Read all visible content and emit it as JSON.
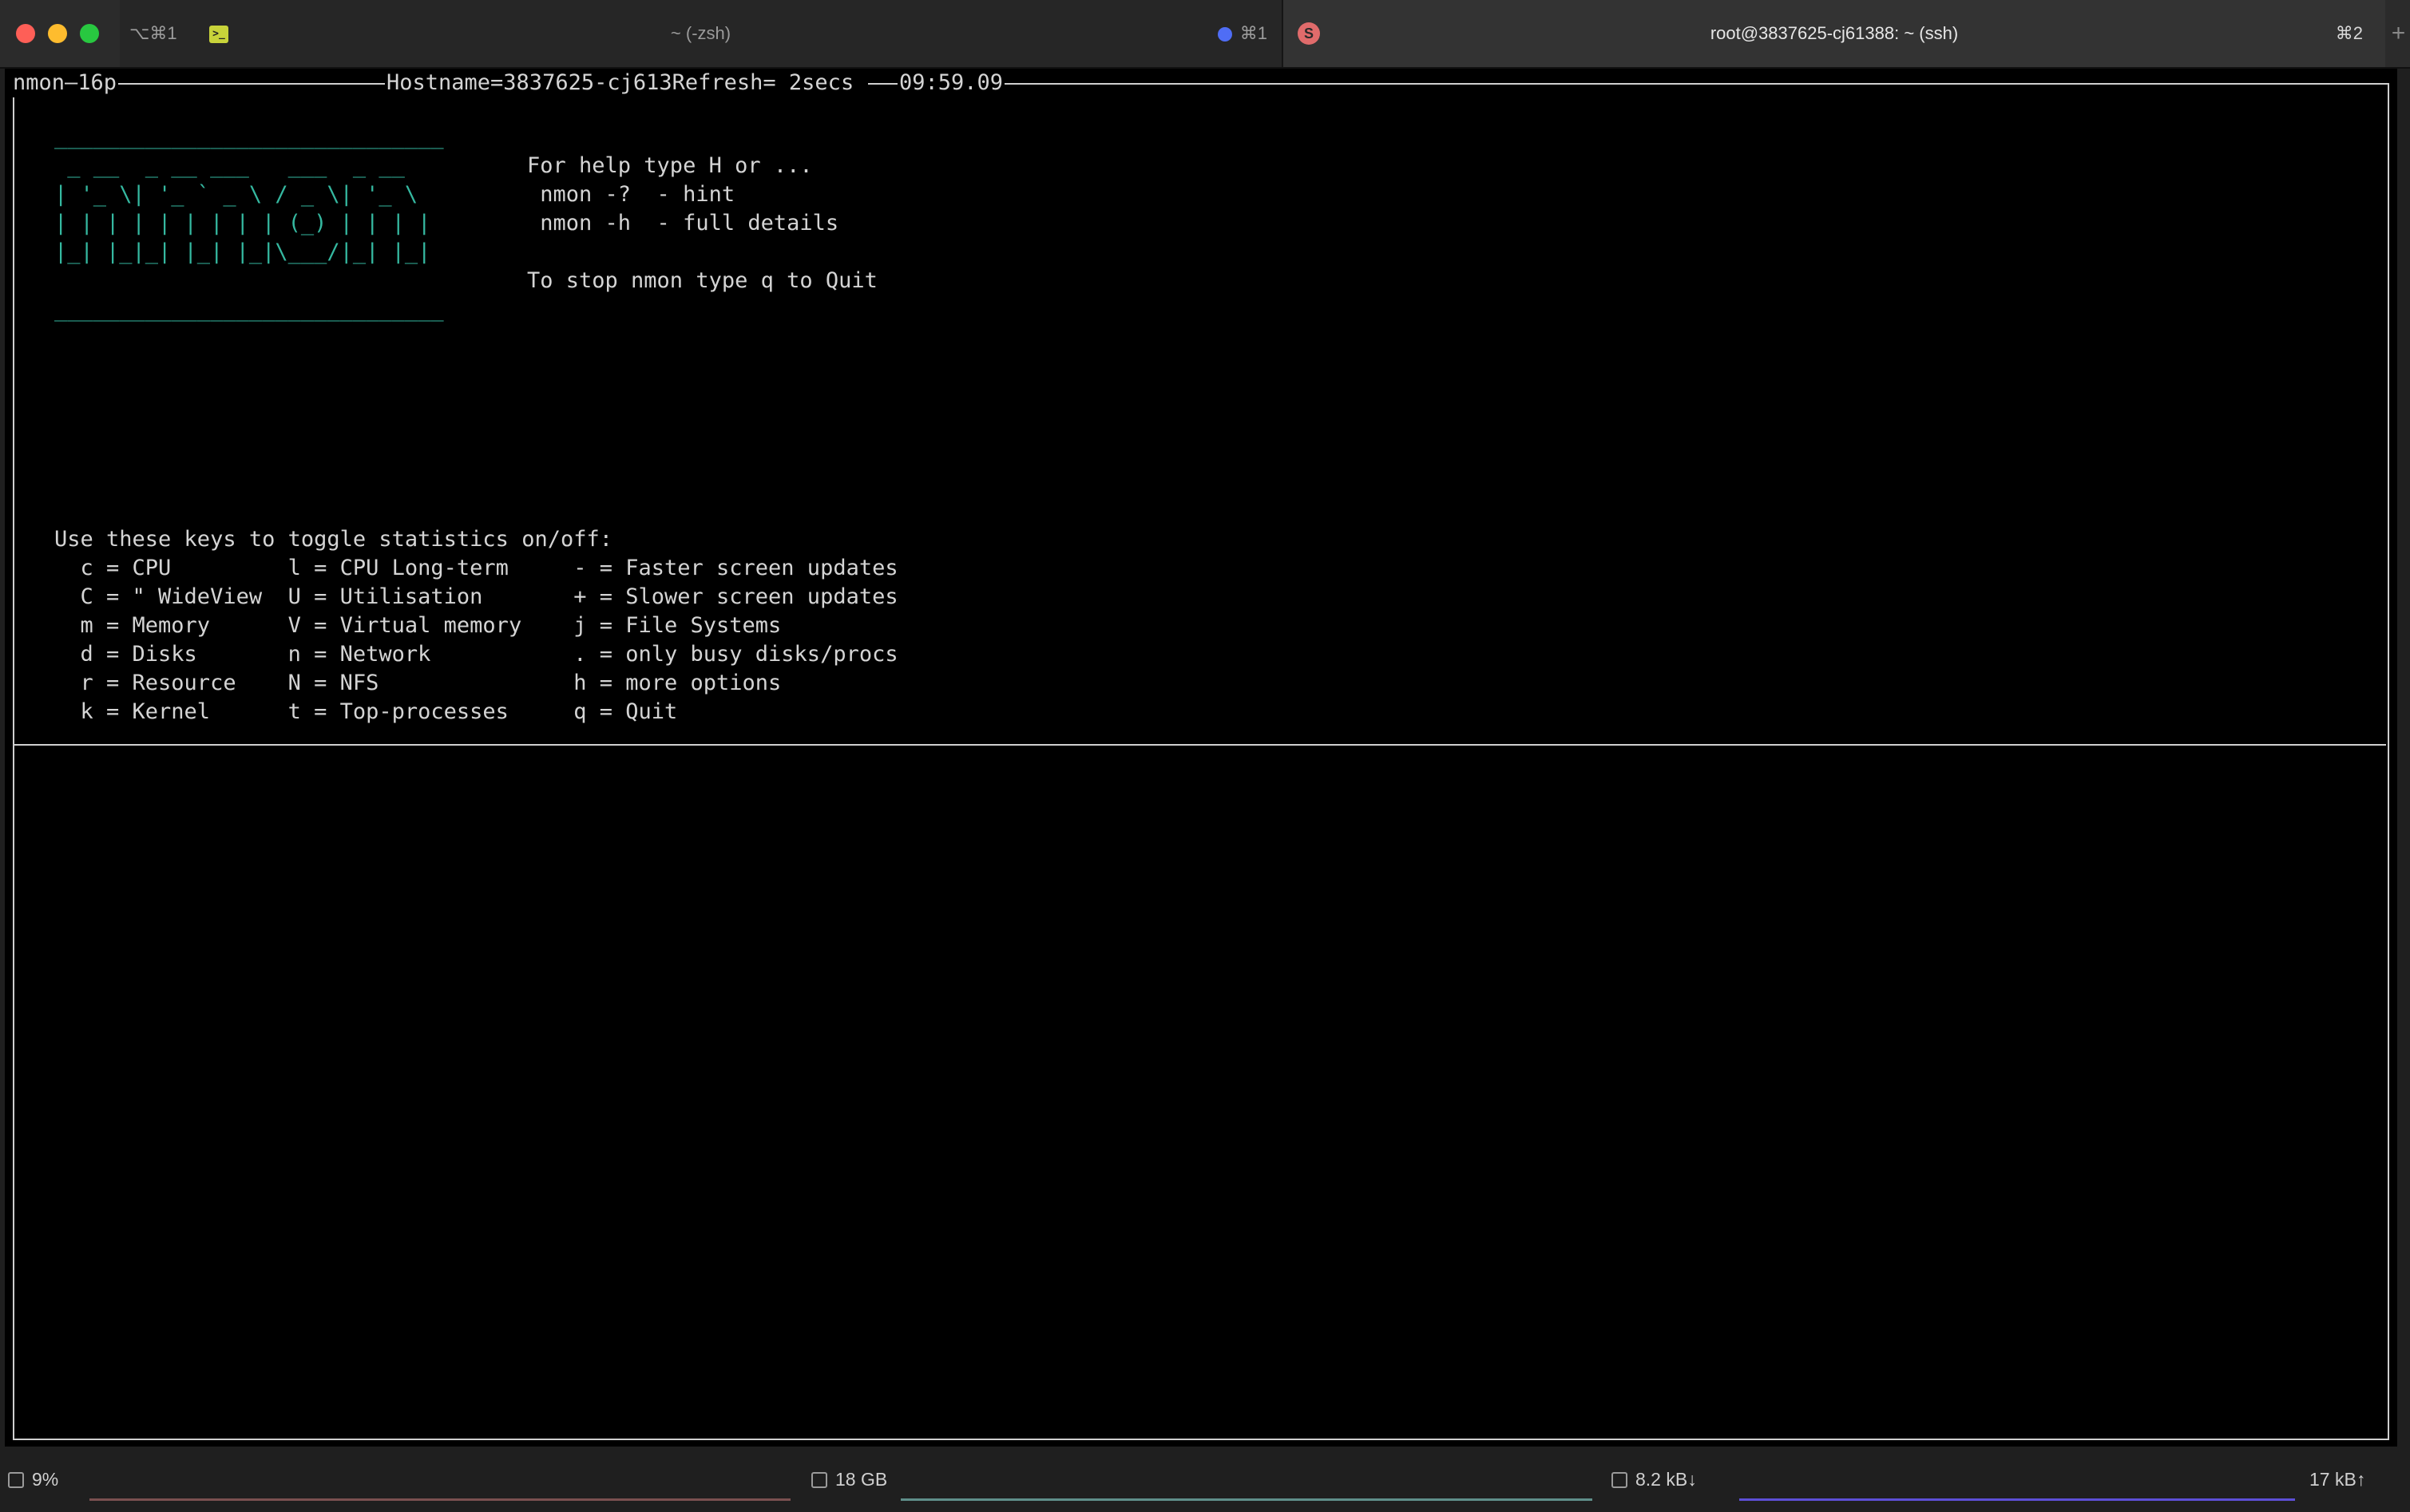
{
  "window": {
    "tabs": [
      {
        "shortcut": "⌥⌘1",
        "title": "~ (-zsh)",
        "badge_shortcut": "⌘1"
      },
      {
        "title": "root@3837625-cj61388: ~ (ssh)",
        "shortcut": "⌘2",
        "icon_letter": "S"
      }
    ],
    "new_tab_label": "+"
  },
  "terminal": {
    "header": {
      "left": "nmon—16p",
      "hostname": "Hostname=3837625-cj613Refresh= 2secs ",
      "time": "09:59.09"
    },
    "logo_lines": [
      "______________________________",
      " _ __  _ __ ___   ___  _ __  ",
      "| '_ \\| '_ ` _ \\ / _ \\| '_ \\ ",
      "| | | | | | | | | (_) | | | |",
      "|_| |_|_| |_| |_|\\___/|_| |_|",
      "",
      "______________________________"
    ],
    "help_lines": [
      "For help type H or ...",
      " nmon -?  - hint",
      " nmon -h  - full details",
      "",
      "To stop nmon type q to Quit"
    ],
    "keys_intro": "Use these keys to toggle statistics on/off:",
    "keys_lines": [
      "  c = CPU         l = CPU Long-term     - = Faster screen updates",
      "  C = \" WideView  U = Utilisation       + = Slower screen updates",
      "  m = Memory      V = Virtual memory    j = File Systems",
      "  d = Disks       n = Network           . = only busy disks/procs",
      "  r = Resource    N = NFS               h = more options",
      "  k = Kernel      t = Top-processes     q = Quit"
    ]
  },
  "statusbar": {
    "cpu": "9%",
    "memory": "18 GB",
    "net_down": "8.2 kB↓",
    "net_up": "17 kB↑"
  },
  "colors": {
    "logo": "#35b8a0",
    "terminal_text": "#d4d4d4",
    "net_graph": "#5d4fd6"
  }
}
